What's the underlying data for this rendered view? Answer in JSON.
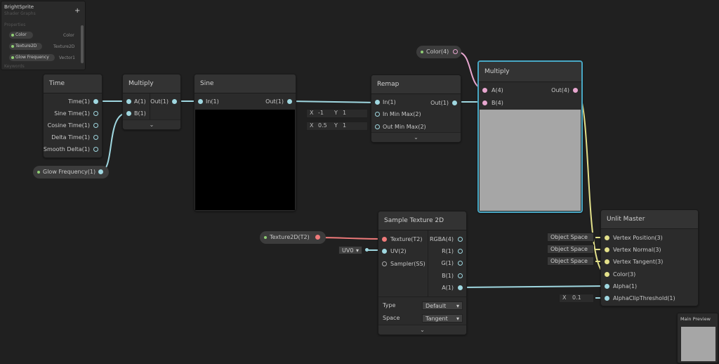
{
  "blackboard": {
    "title": "BrightSprite",
    "subtitle": "Shader Graphs",
    "section_properties": "Properties",
    "section_keywords": "Keywords",
    "add_icon": "+",
    "properties": [
      {
        "name": "Color",
        "type": "Color"
      },
      {
        "name": "Texture2D",
        "type": "Texture2D"
      },
      {
        "name": "Glow Frequency",
        "type": "Vector1"
      }
    ]
  },
  "nodes": {
    "time": {
      "title": "Time",
      "ports": [
        "Time(1)",
        "Sine Time(1)",
        "Cosine Time(1)",
        "Delta Time(1)",
        "Smooth Delta(1)"
      ]
    },
    "multiply1": {
      "title": "Multiply",
      "in": [
        "A(1)",
        "B(1)"
      ],
      "out": "Out(1)",
      "expander": "⌄"
    },
    "sine": {
      "title": "Sine",
      "in": "In(1)",
      "out": "Out(1)"
    },
    "remap": {
      "title": "Remap",
      "in": [
        "In(1)",
        "In Min Max(2)",
        "Out Min Max(2)"
      ],
      "out": "Out(1)",
      "expander": "⌄",
      "inminmax": {
        "x_label": "X",
        "x": "-1",
        "y_label": "Y",
        "y": "1"
      },
      "outminmax": {
        "x_label": "X",
        "x": "0.5",
        "y_label": "Y",
        "y": "1"
      }
    },
    "multiply2": {
      "title": "Multiply",
      "in": [
        "A(4)",
        "B(4)"
      ],
      "out": "Out(4)"
    },
    "sample": {
      "title": "Sample Texture 2D",
      "in": [
        "Texture(T2)",
        "UV(2)",
        "Sampler(SS)"
      ],
      "out": [
        "RGBA(4)",
        "R(1)",
        "G(1)",
        "B(1)",
        "A(1)"
      ],
      "type_label": "Type",
      "type_value": "Default",
      "space_label": "Space",
      "space_value": "Tangent",
      "expander": "⌄",
      "uv_value": "UV0"
    },
    "master": {
      "title": "Unlit Master",
      "in": [
        "Vertex Position(3)",
        "Vertex Normal(3)",
        "Vertex Tangent(3)",
        "Color(3)",
        "Alpha(1)",
        "AlphaClipThreshold(1)"
      ],
      "space_fields": [
        "Object Space",
        "Object Space",
        "Object Space"
      ],
      "alpha_clip": {
        "x_label": "X",
        "x": "0.1"
      }
    }
  },
  "properties_nodes": {
    "color": "Color(4)",
    "glow": "Glow Frequency(1)",
    "texture": "Texture2D(T2)"
  },
  "main_preview": {
    "title": "Main Preview"
  }
}
